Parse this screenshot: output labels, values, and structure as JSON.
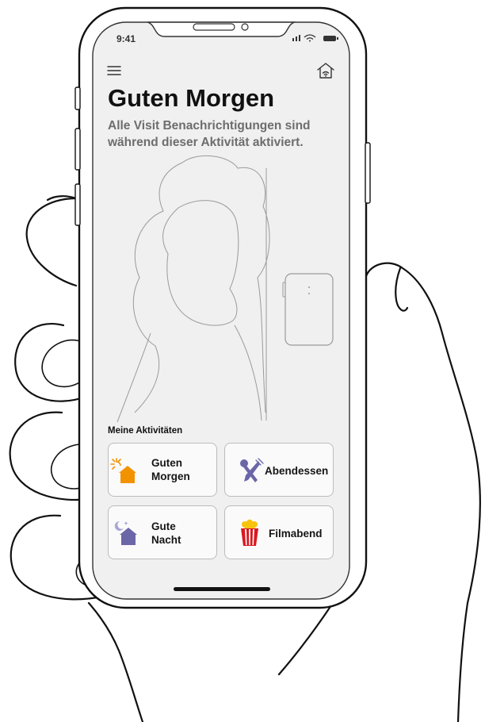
{
  "status_bar": {
    "time": "9:41"
  },
  "header": {
    "menu_icon": "hamburger-menu-icon",
    "home_icon": "smart-home-icon"
  },
  "title": "Guten Morgen",
  "subtitle_lines": [
    "Alle Visit Benachrichtigungen sind",
    "während dieser Aktivität aktiviert."
  ],
  "section_label": "Meine Aktivitäten",
  "activities": [
    {
      "lines": [
        "Guten",
        "Morgen"
      ],
      "icon": "sunrise-house-icon"
    },
    {
      "lines": [
        "Abendessen"
      ],
      "icon": "cutlery-icon"
    },
    {
      "lines": [
        "Gute",
        "Nacht"
      ],
      "icon": "moon-house-icon"
    },
    {
      "lines": [
        "Filmabend"
      ],
      "icon": "popcorn-icon"
    }
  ],
  "colors": {
    "accent_orange": "#f39200",
    "accent_purple": "#6a66a8",
    "popcorn_red": "#d91920",
    "popcorn_yellow": "#f7c30f"
  }
}
